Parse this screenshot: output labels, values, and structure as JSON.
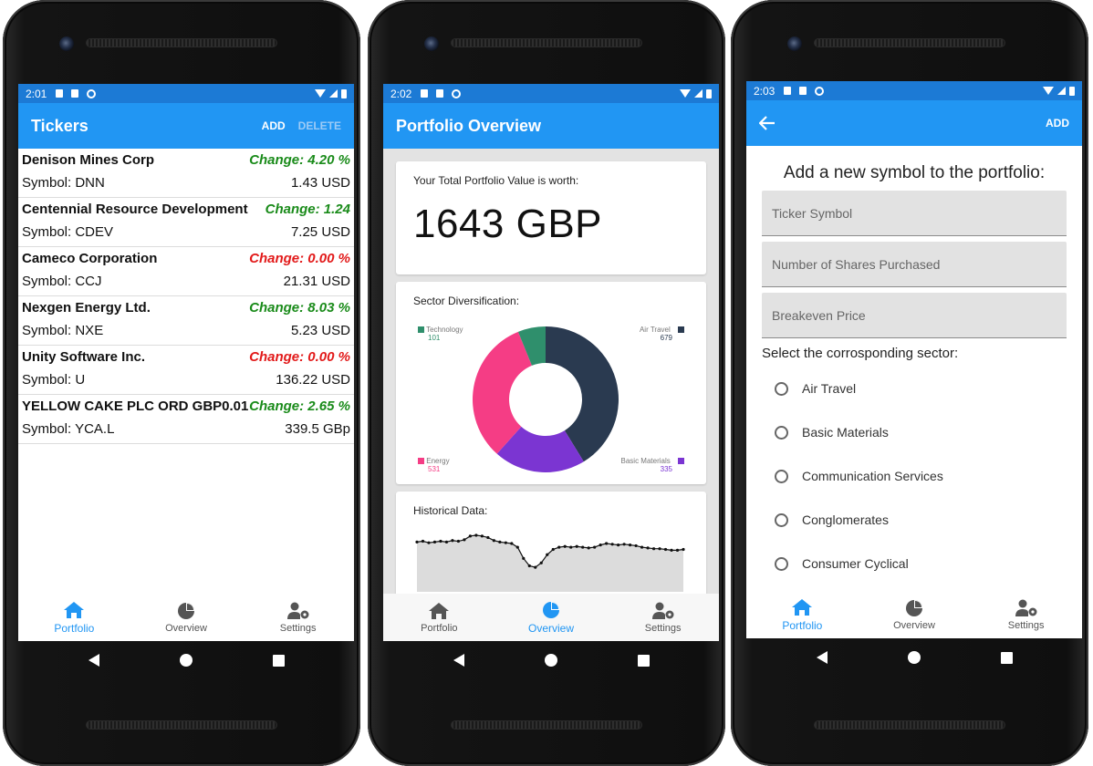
{
  "status": {
    "time1": "2:01",
    "time2": "2:02",
    "time3": "2:03"
  },
  "screen1": {
    "title": "Tickers",
    "add_label": "ADD",
    "delete_label": "DELETE",
    "tickers": [
      {
        "name": "Denison Mines Corp",
        "change": "Change: 4.20 %",
        "symbol": "Symbol: DNN",
        "price": "1.43 USD",
        "trend": "up"
      },
      {
        "name": "Centennial Resource Development",
        "change": "Change: 1.24",
        "symbol": "Symbol: CDEV",
        "price": "7.25 USD",
        "trend": "up"
      },
      {
        "name": "Cameco Corporation",
        "change": "Change: 0.00 %",
        "symbol": "Symbol: CCJ",
        "price": "21.31 USD",
        "trend": "flat"
      },
      {
        "name": "Nexgen Energy Ltd.",
        "change": "Change: 8.03 %",
        "symbol": "Symbol: NXE",
        "price": "5.23 USD",
        "trend": "up"
      },
      {
        "name": "Unity Software Inc.",
        "change": "Change: 0.00 %",
        "symbol": "Symbol: U",
        "price": "136.22 USD",
        "trend": "flat"
      },
      {
        "name": "YELLOW CAKE PLC ORD GBP0.01",
        "change": "Change: 2.65 %",
        "symbol": "Symbol: YCA.L",
        "price": "339.5 GBp",
        "trend": "up"
      }
    ]
  },
  "screen2": {
    "title": "Portfolio Overview",
    "value_label": "Your Total Portfolio Value is worth:",
    "value": "1643 GBP",
    "sector_label": "Sector Diversification:",
    "historical_label": "Historical Data:"
  },
  "screen3": {
    "add_label": "ADD",
    "form_title": "Add a new symbol to the portfolio:",
    "fields": [
      "Ticker Symbol",
      "Number of Shares Purchased",
      "Breakeven Price"
    ],
    "sector_prompt": "Select the corrosponding sector:",
    "sectors": [
      "Air Travel",
      "Basic Materials",
      "Communication Services",
      "Conglomerates",
      "Consumer Cyclical"
    ]
  },
  "nav": {
    "portfolio": "Portfolio",
    "overview": "Overview",
    "settings": "Settings"
  },
  "colors": {
    "accent": "#2196f3",
    "statusbar": "#1c7ad5",
    "positive": "#1a8b1a",
    "negative": "#e21a1a"
  },
  "chart_data": [
    {
      "type": "pie",
      "title": "Sector Diversification:",
      "categories": [
        "Air Travel",
        "Basic Materials",
        "Energy",
        "Technology"
      ],
      "values": [
        679,
        335,
        531,
        101
      ],
      "colors": [
        "#2a3a50",
        "#7b35d2",
        "#f53d85",
        "#2f8f6c"
      ]
    },
    {
      "type": "area",
      "title": "Historical Data:",
      "values": [
        62,
        63,
        61,
        62,
        63,
        62,
        64,
        63,
        65,
        70,
        71,
        70,
        68,
        64,
        62,
        61,
        60,
        55,
        40,
        30,
        28,
        34,
        45,
        52,
        55,
        56,
        55,
        56,
        55,
        54,
        55,
        58,
        60,
        59,
        58,
        59,
        58,
        57,
        55,
        54,
        53,
        53,
        52,
        51,
        51,
        52
      ]
    }
  ]
}
